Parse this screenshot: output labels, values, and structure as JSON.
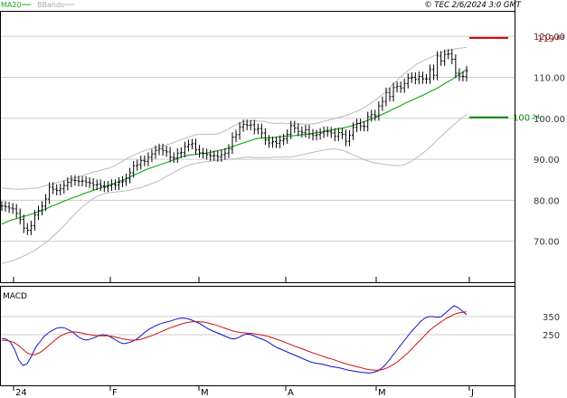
{
  "header": {
    "legend_ma": "MA20",
    "legend_bb": "BBands",
    "copyright_label": "© TEC 2/6/2024 3:0 GMT"
  },
  "colors": {
    "price_bars": "#000000",
    "ma20": "#22aa22",
    "bbands": "#bbbbbb",
    "macd": "#1010cc",
    "signal": "#cc1010",
    "resistance": "#cc0000",
    "support": "#008800",
    "grid": "#cccccc"
  },
  "chart_data": [
    {
      "type": "ohlc",
      "title": "",
      "y_ticks": [
        {
          "value": 70,
          "label": "70.00"
        },
        {
          "value": 80,
          "label": "80.00"
        },
        {
          "value": 90,
          "label": "90.00"
        },
        {
          "value": 100,
          "label": "100.00"
        },
        {
          "value": 110,
          "label": "110.00"
        },
        {
          "value": 120,
          "label": "120.00"
        }
      ],
      "ylim": [
        60,
        126
      ],
      "x_labels": [
        "24",
        "F",
        "M",
        "A",
        "M",
        "J"
      ],
      "grid": true,
      "levels": [
        {
          "name": "resistance",
          "value": 119.63,
          "label_main": "119",
          "label_frac": ".63"
        },
        {
          "name": "support",
          "value": 100.24,
          "label_main": "100",
          "label_frac": ".24"
        }
      ],
      "series": [
        {
          "name": "MA20",
          "kind": "line"
        },
        {
          "name": "BBands",
          "kind": "band"
        }
      ],
      "price_close": [
        78.6,
        78.4,
        78.1,
        77.9,
        76.8,
        75.3,
        73.2,
        72.7,
        73.8,
        76.4,
        77.5,
        78.6,
        80.3,
        83.2,
        82.7,
        82.4,
        82.8,
        83.6,
        84.4,
        84.9,
        84.8,
        84.6,
        84.7,
        84.4,
        84.2,
        83.7,
        83.9,
        83.5,
        83.2,
        83.5,
        83.9,
        83.7,
        84.4,
        84.7,
        85.3,
        86.7,
        88.4,
        88.7,
        89.7,
        89.5,
        90.5,
        91.3,
        92.2,
        92.6,
        92.1,
        91.8,
        90.5,
        90.3,
        91.5,
        91.7,
        93.1,
        93.6,
        93.8,
        92.3,
        91.6,
        91.4,
        91.1,
        90.8,
        90.9,
        90.6,
        91.1,
        91.5,
        92.5,
        95.4,
        96.0,
        97.9,
        98.5,
        98.3,
        98.4,
        97.3,
        97.5,
        96.4,
        94.7,
        94.0,
        94.3,
        93.9,
        94.6,
        95.0,
        96.1,
        98.2,
        97.6,
        96.8,
        96.5,
        97.2,
        96.2,
        95.8,
        96.0,
        96.4,
        96.8,
        96.7,
        96.4,
        95.6,
        96.5,
        96.1,
        94.4,
        95.9,
        97.8,
        98.7,
        98.1,
        98.0,
        100.4,
        100.9,
        100.6,
        103.0,
        104.1,
        106.3,
        105.3,
        107.5,
        107.8,
        107.4,
        108.5,
        109.8,
        110.0,
        109.5,
        110.2,
        109.6,
        109.6,
        111.9,
        110.5,
        115.2,
        114.0,
        115.6,
        115.7,
        114.4,
        111.0,
        110.3,
        110.2,
        111.6
      ],
      "ma20": [
        74.2,
        74.6,
        75.0,
        75.3,
        75.5,
        75.8,
        76.1,
        76.3,
        76.6,
        76.9,
        77.2,
        77.5,
        77.9,
        78.3,
        78.7,
        79.0,
        79.4,
        79.8,
        80.1,
        80.5,
        80.8,
        81.1,
        81.5,
        81.8,
        82.1,
        82.4,
        82.7,
        83.0,
        83.3,
        83.6,
        83.9,
        84.2,
        84.6,
        84.9,
        85.3,
        85.7,
        86.1,
        86.5,
        86.9,
        87.3,
        87.7,
        88.0,
        88.3,
        88.6,
        88.9,
        89.2,
        89.5,
        89.9,
        90.2,
        90.6,
        90.8,
        91.0,
        91.1,
        91.2,
        91.3,
        91.4,
        91.5,
        91.7,
        91.9,
        92.1,
        92.3,
        92.5,
        92.8,
        93.1,
        93.4,
        93.7,
        94.0,
        94.3,
        94.6,
        94.9,
        95.1,
        95.2,
        95.2,
        95.2,
        95.3,
        95.4,
        95.5,
        95.6,
        95.7,
        95.7,
        95.8,
        95.9,
        96.0,
        96.1,
        96.2,
        96.3,
        96.5,
        96.6,
        96.8,
        97.0,
        97.1,
        97.3,
        97.5,
        97.6,
        97.8,
        98.0,
        98.3,
        98.6,
        98.9,
        99.2,
        99.5,
        99.9,
        100.2,
        100.6,
        101.0,
        101.4,
        101.8,
        102.3,
        102.7,
        103.1,
        103.6,
        104.0,
        104.4,
        104.8,
        105.2,
        105.6,
        106.0,
        106.5,
        106.9,
        107.4,
        107.9,
        108.5,
        109.0,
        109.5,
        110.1,
        110.7,
        111.3,
        111.9
      ],
      "bb_upper": [
        83.0,
        82.9,
        82.8,
        82.8,
        82.7,
        82.7,
        82.8,
        82.8,
        82.9,
        82.9,
        83.1,
        83.3,
        83.6,
        83.8,
        84.0,
        84.3,
        84.5,
        84.8,
        85.1,
        85.3,
        85.5,
        85.7,
        86.0,
        86.3,
        86.6,
        86.9,
        87.1,
        87.3,
        87.6,
        87.8,
        88.1,
        88.5,
        89.0,
        89.5,
        90.1,
        90.6,
        91.0,
        91.4,
        91.8,
        92.1,
        92.4,
        92.7,
        92.9,
        93.1,
        93.3,
        93.5,
        93.8,
        94.1,
        94.5,
        94.8,
        95.1,
        95.4,
        95.7,
        96.0,
        96.1,
        96.2,
        96.1,
        96.1,
        96.1,
        96.2,
        96.5,
        96.9,
        97.4,
        98.0,
        98.4,
        98.8,
        99.2,
        99.3,
        99.4,
        99.5,
        99.3,
        99.3,
        99.2,
        98.9,
        98.8,
        98.8,
        98.8,
        98.8,
        98.7,
        98.7,
        98.7,
        98.7,
        98.6,
        98.6,
        98.6,
        98.7,
        98.8,
        99.0,
        99.3,
        99.5,
        99.7,
        99.9,
        100.2,
        100.4,
        100.7,
        101.0,
        101.4,
        101.7,
        102.1,
        102.6,
        103.2,
        103.8,
        104.4,
        105.1,
        105.8,
        106.6,
        107.5,
        108.4,
        109.3,
        110.1,
        110.9,
        111.6,
        112.3,
        113.0,
        113.5,
        114.0,
        114.4,
        114.8,
        115.2,
        115.6,
        116.0,
        116.3,
        116.6,
        116.8,
        117.0,
        117.1,
        117.2,
        117.3
      ],
      "bb_lower": [
        64.6,
        64.8,
        65.0,
        65.3,
        65.6,
        66.0,
        66.4,
        66.8,
        67.3,
        67.8,
        68.4,
        69.0,
        69.7,
        70.4,
        71.2,
        72.0,
        72.9,
        73.8,
        74.8,
        75.8,
        76.7,
        77.6,
        78.4,
        79.1,
        79.8,
        80.4,
        80.9,
        81.3,
        81.6,
        81.8,
        81.9,
        82.0,
        82.1,
        82.2,
        82.3,
        82.5,
        82.7,
        82.9,
        83.1,
        83.4,
        83.7,
        84.1,
        84.4,
        84.8,
        85.3,
        85.8,
        86.3,
        86.8,
        87.3,
        87.8,
        88.2,
        88.5,
        88.8,
        89.0,
        89.2,
        89.3,
        89.4,
        89.5,
        89.6,
        89.7,
        89.8,
        89.9,
        90.0,
        90.1,
        90.2,
        90.3,
        90.4,
        90.5,
        90.5,
        90.4,
        90.4,
        90.4,
        90.4,
        90.4,
        90.5,
        90.5,
        90.5,
        90.5,
        90.6,
        90.6,
        90.7,
        90.9,
        91.1,
        91.3,
        91.5,
        91.7,
        91.9,
        92.1,
        92.3,
        92.4,
        92.5,
        92.5,
        92.4,
        92.2,
        91.9,
        91.5,
        91.1,
        90.7,
        90.3,
        89.9,
        89.6,
        89.3,
        89.1,
        89.0,
        88.8,
        88.7,
        88.6,
        88.5,
        88.4,
        88.5,
        88.7,
        89.1,
        89.6,
        90.2,
        90.8,
        91.5,
        92.2,
        93.0,
        93.8,
        94.7,
        95.6,
        96.4,
        97.2,
        98.0,
        98.8,
        99.6,
        100.3,
        101.0
      ]
    },
    {
      "type": "line",
      "title": "MACD",
      "ylim": [
        -90,
        180
      ],
      "y_ticks": [
        {
          "value": 100,
          "label": "350"
        },
        {
          "value": 50,
          "label": "250"
        }
      ],
      "grid": true,
      "series": [
        {
          "name": "MACD",
          "color_key": "macd",
          "values": [
            40,
            38,
            30,
            10,
            -20,
            -35,
            -30,
            -10,
            15,
            30,
            45,
            55,
            62,
            68,
            70,
            68,
            62,
            55,
            45,
            38,
            35,
            38,
            42,
            48,
            50,
            48,
            42,
            35,
            28,
            25,
            28,
            32,
            38,
            48,
            58,
            66,
            72,
            78,
            82,
            85,
            88,
            92,
            95,
            96,
            94,
            90,
            85,
            80,
            72,
            65,
            60,
            55,
            50,
            45,
            40,
            38,
            42,
            48,
            52,
            50,
            45,
            40,
            36,
            30,
            22,
            15,
            10,
            5,
            0,
            -5,
            -10,
            -15,
            -20,
            -25,
            -28,
            -30,
            -32,
            -35,
            -38,
            -40,
            -42,
            -45,
            -48,
            -50,
            -52,
            -54,
            -55,
            -56,
            -54,
            -50,
            -42,
            -30,
            -15,
            0,
            15,
            30,
            45,
            60,
            72,
            85,
            95,
            100,
            100,
            98,
            100,
            110,
            120,
            130,
            125,
            115,
            105
          ]
        },
        {
          "name": "Signal",
          "color_key": "signal",
          "values": [
            35,
            34,
            32,
            28,
            20,
            10,
            0,
            -5,
            -5,
            0,
            8,
            18,
            28,
            38,
            46,
            52,
            56,
            58,
            57,
            55,
            52,
            50,
            48,
            47,
            47,
            47,
            46,
            44,
            41,
            38,
            36,
            35,
            35,
            37,
            40,
            44,
            48,
            53,
            58,
            63,
            68,
            72,
            76,
            80,
            83,
            85,
            86,
            86,
            85,
            83,
            80,
            77,
            73,
            69,
            65,
            61,
            58,
            56,
            55,
            54,
            53,
            51,
            49,
            47,
            44,
            40,
            36,
            32,
            27,
            23,
            18,
            14,
            10,
            5,
            1,
            -3,
            -7,
            -11,
            -15,
            -18,
            -22,
            -26,
            -30,
            -33,
            -36,
            -39,
            -42,
            -45,
            -47,
            -48,
            -48,
            -46,
            -42,
            -36,
            -29,
            -20,
            -10,
            0,
            12,
            24,
            36,
            48,
            60,
            70,
            78,
            86,
            94,
            100,
            106,
            110,
            112,
            113
          ]
        }
      ],
      "x_labels": [
        "24",
        "F",
        "M",
        "A",
        "M",
        "J"
      ]
    }
  ]
}
